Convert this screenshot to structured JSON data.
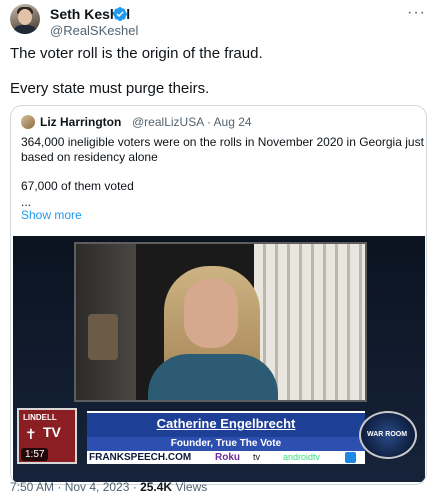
{
  "tweet": {
    "author_name": "Seth Keshel",
    "author_handle": "@RealSKeshel",
    "more_icon": "more-icon",
    "lines": [
      "The voter roll is the origin of the fraud.",
      "Every state must purge theirs."
    ],
    "timestamp": "7:50 AM · Nov 4, 2023 · ",
    "views_count": "25.4K",
    "views_label": " Views"
  },
  "quote": {
    "author_name": "Liz Harrington",
    "author_handle": "@realLizUSA · Aug 24",
    "lines": [
      "364,000 ineligible voters were on the rolls in November 2020 in Georgia just",
      "based on residency alone",
      "67,000 of them voted",
      "..."
    ],
    "show_more": "Show more"
  },
  "video": {
    "lower_third_name": "Catherine Engelbrecht",
    "lower_third_title": "Founder, True The Vote",
    "brand": "FRANKSPEECH.COM",
    "roku": "Roku",
    "appletv": "tv",
    "androidtv": "androidtv",
    "lindell_top": "LINDELL",
    "lindell_tv": "TV",
    "war_room": "WAR ROOM",
    "duration": "1:57"
  },
  "colors": {
    "accent": "#1d9bf0",
    "verified": "#1d9bf0",
    "lower_third": "#1e3f96"
  }
}
